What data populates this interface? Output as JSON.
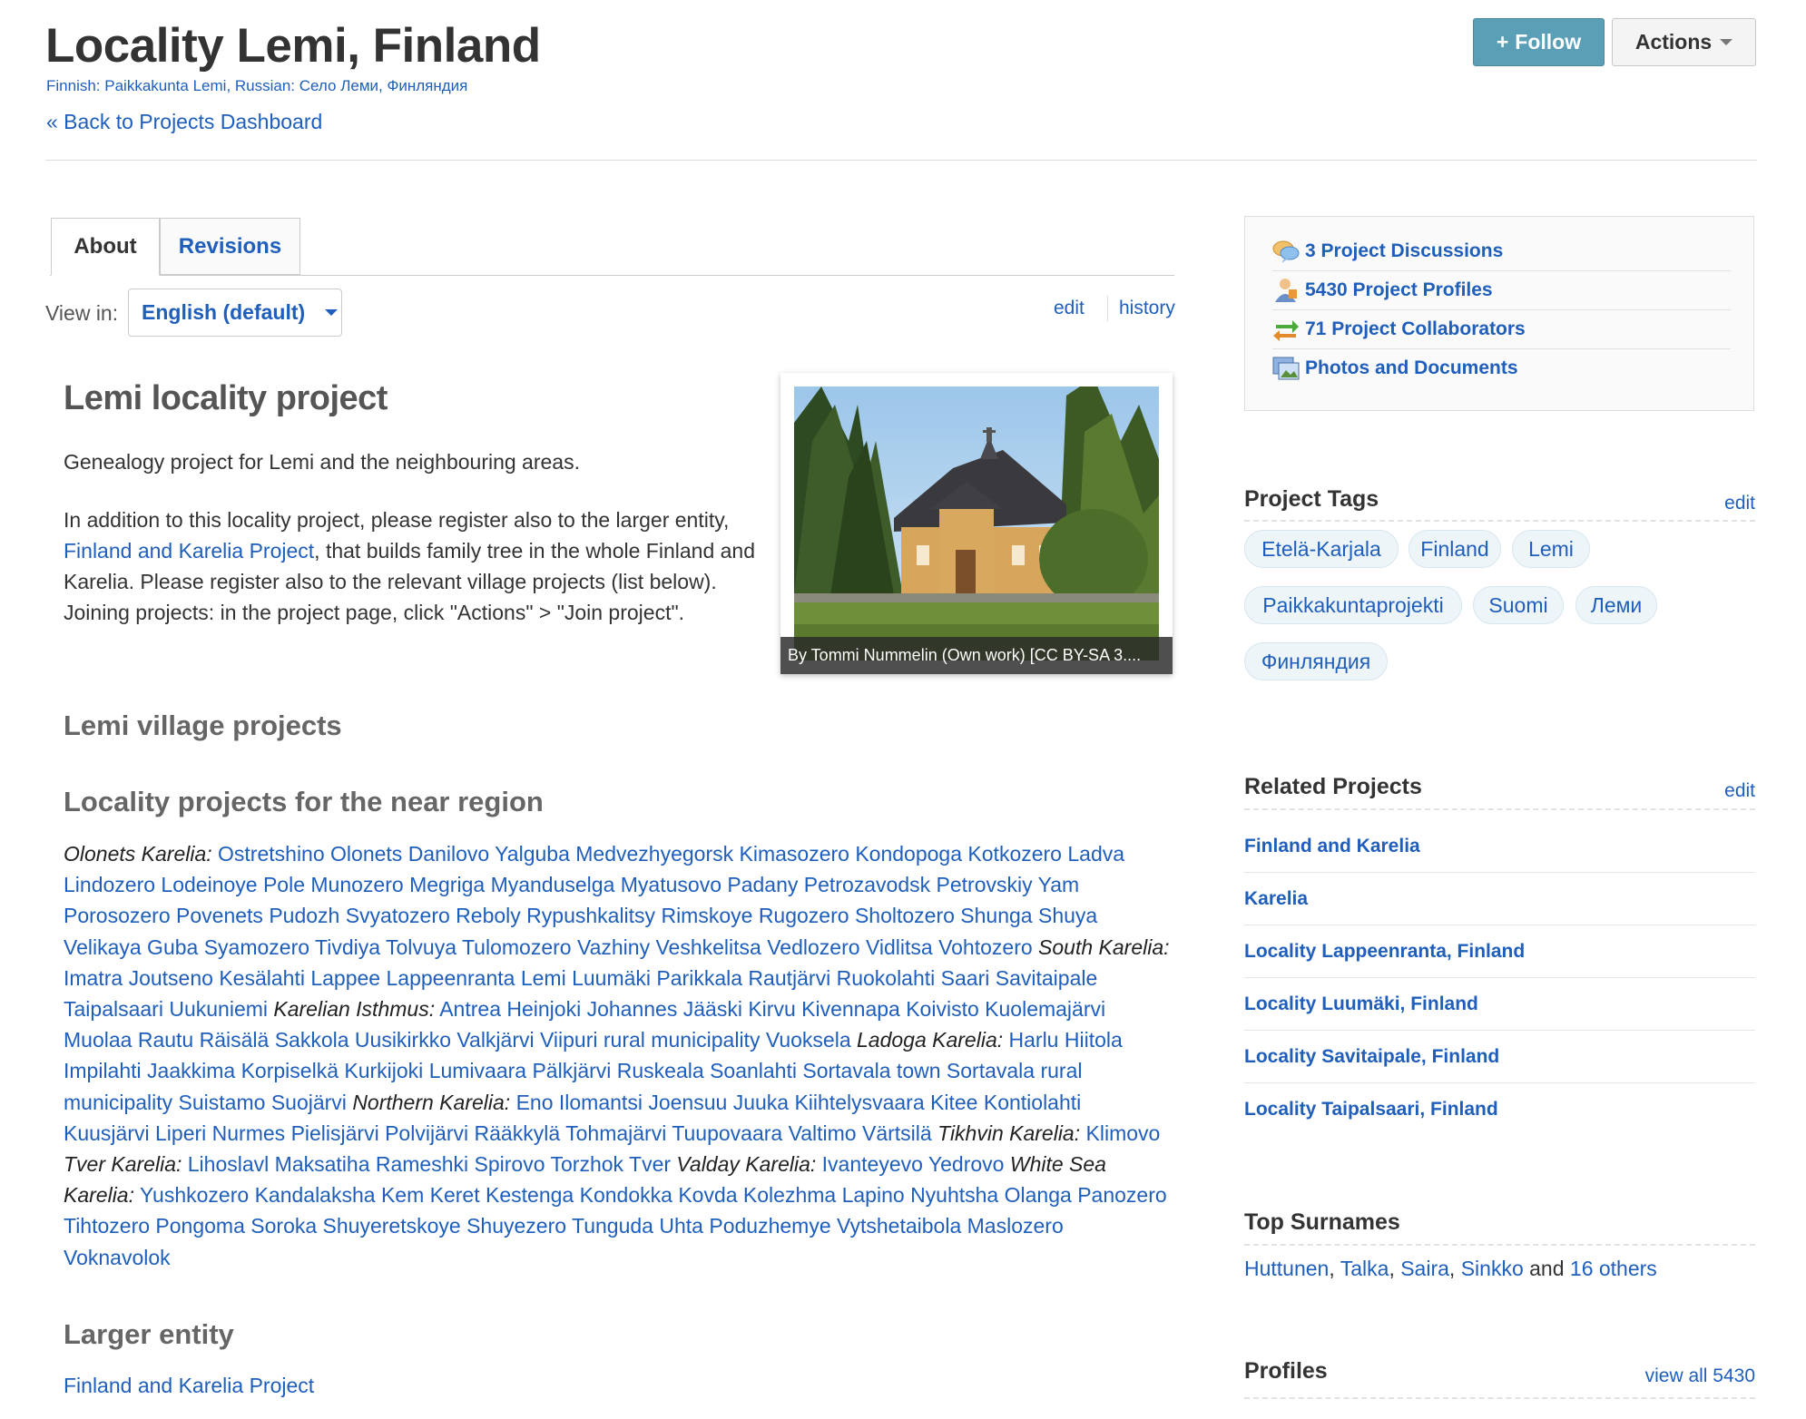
{
  "header": {
    "title": "Locality Lemi, Finland",
    "alt_names_prefix1": "Finnish: ",
    "alt_name_fi": "Paikkakunta Lemi",
    "alt_names_prefix2": ", Russian: ",
    "alt_name_ru": "Село Леми, Финляндия",
    "back_link": "« Back to Projects Dashboard",
    "follow_label": "Follow",
    "follow_icon": "+",
    "actions_label": "Actions"
  },
  "tabs": [
    {
      "label": "About",
      "active": true
    },
    {
      "label": "Revisions",
      "active": false
    }
  ],
  "view_in": {
    "label": "View in:",
    "selected": "English (default)"
  },
  "controls": {
    "edit": "edit",
    "history": "history"
  },
  "about": {
    "heading": "Lemi locality project",
    "p1": "Genealogy project for Lemi and the neighbouring areas.",
    "p2_a": "In addition to this locality project, please register also to the larger entity, ",
    "p2_link": "Finland and Karelia Project",
    "p2_b": ", that builds family tree in the whole Finland and Karelia. Please register also to the relevant village projects (list below). Joining projects: in the project page, click \"Actions\" > \"Join project\".",
    "village_heading": "Lemi village projects",
    "near_heading": "Locality projects for the near region",
    "larger_heading": "Larger entity",
    "larger_link": "Finland and Karelia Project",
    "photo_caption": "By Tommi Nummelin (Own work) [CC BY-SA 3...."
  },
  "regions": [
    {
      "name": "Olonets Karelia:",
      "places": [
        "Ostretshino",
        "Olonets",
        "Danilovo",
        "Yalguba",
        "Medvezhyegorsk",
        "Kimasozero",
        "Kondopoga",
        "Kotkozero",
        "Ladva",
        "Lindozero",
        "Lodeinoye Pole",
        "Munozero",
        "Megriga",
        "Myanduselga",
        "Myatusovo",
        "Padany",
        "Petrozavodsk",
        "Petrovskiy Yam",
        "Porosozero",
        "Povenets",
        "Pudozh",
        "Svyatozero",
        "Reboly",
        "Rypushkalitsy",
        "Rimskoye",
        "Rugozero",
        "Sholtozero",
        "Shunga",
        "Shuya",
        "Velikaya Guba",
        "Syamozero",
        "Tivdiya",
        "Tolvuya",
        "Tulomozero",
        "Vazhiny",
        "Veshkelitsa",
        "Vedlozero",
        "Vidlitsa",
        "Vohtozero"
      ]
    },
    {
      "name": "South Karelia:",
      "places": [
        "Imatra",
        "Joutseno",
        "Kesälahti",
        "Lappee",
        "Lappeenranta",
        "Lemi",
        "Luumäki",
        "Parikkala",
        "Rautjärvi",
        "Ruokolahti",
        "Saari",
        "Savitaipale",
        "Taipalsaari",
        "Uukuniemi"
      ]
    },
    {
      "name": "Karelian Isthmus:",
      "places": [
        "Antrea",
        "Heinjoki",
        "Johannes",
        "Jääski",
        "Kirvu",
        "Kivennapa",
        "Koivisto",
        "Kuolemajärvi",
        "Muolaa",
        "Rautu",
        "Räisälä",
        "Sakkola",
        "Uusikirkko",
        "Valkjärvi",
        "Viipuri rural municipality",
        "Vuoksela"
      ]
    },
    {
      "name": "Ladoga Karelia:",
      "places": [
        "Harlu",
        "Hiitola",
        "Impilahti",
        "Jaakkima",
        "Korpiselkä",
        "Kurkijoki",
        "Lumivaara",
        "Pälkjärvi",
        "Ruskeala",
        "Soanlahti",
        "Sortavala town",
        "Sortavala rural municipality",
        "Suistamo",
        "Suojärvi"
      ]
    },
    {
      "name": "Northern Karelia:",
      "places": [
        "Eno",
        "Ilomantsi",
        "Joensuu",
        "Juuka",
        "Kiihtelysvaara",
        "Kitee",
        "Kontiolahti",
        "Kuusjärvi",
        "Liperi",
        "Nurmes",
        "Pielisjärvi",
        "Polvijärvi",
        "Rääkkylä",
        "Tohmajärvi",
        "Tuupovaara",
        "Valtimo",
        "Värtsilä"
      ]
    },
    {
      "name": "Tikhvin Karelia:",
      "places": [
        "Klimovo"
      ]
    },
    {
      "name": "Tver Karelia:",
      "places": [
        "Lihoslavl",
        "Maksatiha",
        "Rameshki",
        "Spirovo",
        "Torzhok",
        "Tver"
      ]
    },
    {
      "name": "Valday Karelia:",
      "places": [
        "Ivanteyevo",
        "Yedrovo"
      ]
    },
    {
      "name": "White Sea Karelia:",
      "places": [
        "Yushkozero",
        "Kandalaksha",
        "Kem",
        "Keret",
        "Kestenga",
        "Kondokka",
        "Kovda",
        "Kolezhma",
        "Lapino",
        "Nyuhtsha",
        "Olanga",
        "Panozero",
        "Tihtozero",
        "Pongoma",
        "Soroka",
        "Shuyeretskoye",
        "Shuyezero",
        "Tunguda",
        "Uhta",
        "Poduzhemye",
        "Vytshetaibola",
        "Maslozero",
        "Voknavolok"
      ]
    }
  ],
  "sidebar": {
    "stats": [
      {
        "label": "3 Project Discussions",
        "icon": "discussion-icon"
      },
      {
        "label": "5430 Project Profiles",
        "icon": "profiles-icon"
      },
      {
        "label": "71 Project Collaborators",
        "icon": "collaborators-icon"
      },
      {
        "label": "Photos and Documents",
        "icon": "photos-icon"
      }
    ],
    "tags_heading": "Project Tags",
    "tags_edit": "edit",
    "tags": [
      "Etelä-Karjala",
      "Finland",
      "Lemi",
      "Paikkakuntaprojekti",
      "Suomi",
      "Леми",
      "Финляндия"
    ],
    "related_heading": "Related Projects",
    "related_edit": "edit",
    "related": [
      "Finland and Karelia",
      "Karelia",
      "Locality Lappeenranta, Finland",
      "Locality Luumäki, Finland",
      "Locality Savitaipale, Finland",
      "Locality Taipalsaari, Finland"
    ],
    "surnames_heading": "Top Surnames",
    "surnames": [
      "Huttunen",
      "Talka",
      "Saira",
      "Sinkko"
    ],
    "surnames_and": " and ",
    "surnames_others": "16 others",
    "profiles_heading": "Profiles",
    "profiles_view_all": "view all 5430"
  },
  "colors": {
    "link": "#1f5fbb",
    "follow_bg": "#5a9fb6",
    "tag_bg": "#eef5f9"
  }
}
